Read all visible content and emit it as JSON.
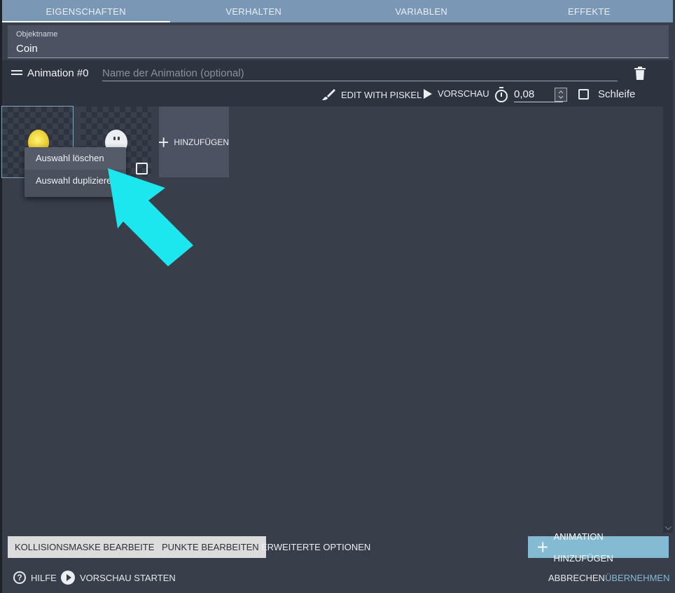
{
  "tabs": [
    {
      "label": "EIGENSCHAFTEN",
      "active": true
    },
    {
      "label": "VERHALTEN",
      "active": false
    },
    {
      "label": "VARIABLEN",
      "active": false
    },
    {
      "label": "EFFEKTE",
      "active": false
    }
  ],
  "object_name": {
    "label": "Objektname",
    "value": "Coin"
  },
  "animation": {
    "title": "Animation #0",
    "name_placeholder": "Name der Animation (optional)",
    "edit_with_piskel": "EDIT WITH PISKEL",
    "preview": "VORSCHAU",
    "timer_value": "0,08",
    "loop_label": "Schleife",
    "add_frame": "HINZUFÜGEN"
  },
  "context_menu": {
    "items": [
      "Auswahl löschen",
      "Auswahl duplizieren"
    ]
  },
  "buttons": {
    "collision_mask": "KOLLISIONSMASKE BEARBEITEN",
    "points": "PUNKTE BEARBEITEN",
    "advanced": "ERWEITERTE OPTIONEN",
    "add_animation": "ANIMATION HINZUFÜGEN"
  },
  "footer": {
    "help": "HILFE",
    "start_preview": "VORSCHAU STARTEN",
    "cancel": "ABBRECHEN",
    "apply": "ÜBERNEHMEN"
  },
  "colors": {
    "tab_bar": "#7b97b6",
    "background": "#383e4a",
    "accent": "#85bad3",
    "arrow": "#1de7ee"
  }
}
